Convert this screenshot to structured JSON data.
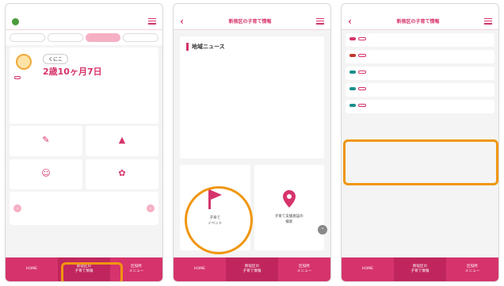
{
  "screen1": {
    "header_title": "",
    "child": {
      "name": "くにこ",
      "age": "2歳10ヶ月7日"
    }
  },
  "screen2": {
    "header_title": "新宿区の子育て情報",
    "news_title": "地域ニュース",
    "card_left_label": "子育て\nイベント",
    "card_right_label": "子育て支援施設の\n検索"
  },
  "screen3": {
    "header_title": "新宿区の子育て情報"
  },
  "nav": {
    "home": "HOME",
    "info": "新宿区の\n子育て情報",
    "mamazine": "区役所\nメニュー"
  },
  "colors": {
    "brand": "#d6336c",
    "highlight": "#f0960f",
    "teal": "#1a8f8c"
  }
}
